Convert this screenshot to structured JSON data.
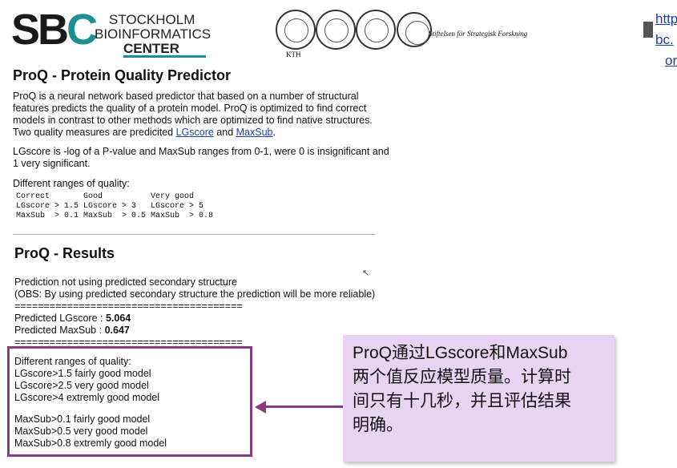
{
  "header": {
    "logo_big": [
      "S",
      "B",
      "C"
    ],
    "logo_lines": [
      "STOCKHOLM",
      "BIOINFORMATICS",
      "CENTER"
    ],
    "kth_label": "KTH",
    "ssf_label": "Stiftelsen för Strategisk Forskning",
    "top_right_links": [
      "http",
      "bc.",
      "or"
    ]
  },
  "intro": {
    "title": "ProQ - Protein Quality Predictor",
    "p1_pre": "ProQ is a neural network based predictor that based on a number of structural features predicts the quality of a protein model. ProQ is optimized to find correct models in contrast to other methods which are optimized to find native structures. Two quality measures are predicited ",
    "link_lgscore": "LGscore",
    "p1_and": " and ",
    "link_maxsub": "MaxSub",
    "p1_end": ".",
    "p2": "LGscore is -log of a P-value and MaxSub ranges from 0-1, were 0 is insignificant and 1 very significant.",
    "p3": "Different ranges of quality:",
    "table": [
      "Correct       Good          Very good",
      "LGscore > 1.5 LGscore > 3   LGscore > 5",
      "MaxSub  > 0.1 MaxSub  > 0.5 MaxSub  > 0.8"
    ]
  },
  "results": {
    "title": "ProQ - Results",
    "line1": "Prediction not using predicted secondary structure",
    "line2": "(OBS: By using predicted secondary structure the prediction will be more reliable)",
    "separator": "=======================================",
    "lg_label": "Predicted LGscore : ",
    "lg_value": "5.064",
    "ms_label": "Predicted MaxSub : ",
    "ms_value": "0.647",
    "ranges_title": "Different ranges of quality:",
    "lg_ranges": [
      "LGscore>1.5 fairly good model",
      "LGscore>2.5 very good model",
      "LGscore>4 extremly good model"
    ],
    "ms_ranges": [
      "MaxSub>0.1 fairly good model",
      "MaxSub>0.5 very good model",
      "MaxSub>0.8 extremly good model"
    ]
  },
  "callout": {
    "text": [
      "ProQ通过LGscore和MaxSub",
      "两个值反应模型质量。计算时",
      "间只有十几秒，并且评估结果",
      "明确。"
    ]
  },
  "colors": {
    "accent_purple": "#8c3a80",
    "callout_bg": "#e6d4f2",
    "logo_teal": "#1f8f92",
    "link": "#1a3fb0"
  }
}
